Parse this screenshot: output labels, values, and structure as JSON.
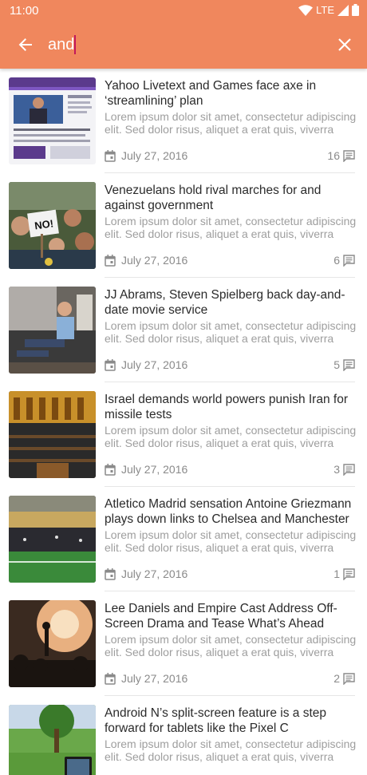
{
  "status_bar": {
    "time": "11:00",
    "network": "LTE"
  },
  "toolbar": {
    "search_value": "and",
    "back_icon": "arrow-back-icon",
    "clear_icon": "close-icon"
  },
  "colors": {
    "accent": "#f0875d",
    "caret": "#c2185b",
    "meta": "#8a8a8a",
    "excerpt": "#9e9e9e"
  },
  "results": [
    {
      "title": "Yahoo Livetext and Games face axe in ‘streamlining’ plan",
      "excerpt": "Lorem ipsum dolor sit amet, consectetur adipiscing elit. Sed dolor risus, aliquet a erat quis, viverra",
      "date": "July 27, 2016",
      "comments": "16",
      "thumb": "web-page-photo"
    },
    {
      "title": "Venezuelans hold rival marches for and against government",
      "excerpt": "Lorem ipsum dolor sit amet, consectetur adipiscing elit. Sed dolor risus, aliquet a erat quis, viverra",
      "date": "July 27, 2016",
      "comments": "6",
      "thumb": "protest-photo"
    },
    {
      "title": "JJ Abrams, Steven Spielberg back day-and-date movie service",
      "excerpt": "Lorem ipsum dolor sit amet, consectetur adipiscing elit. Sed dolor risus, aliquet a erat quis, viverra",
      "date": "July 27, 2016",
      "comments": "5",
      "thumb": "man-on-sofa-photo"
    },
    {
      "title": "Israel demands world powers punish Iran for missile tests",
      "excerpt": "Lorem ipsum dolor sit amet, consectetur adipiscing elit. Sed dolor risus, aliquet a erat quis, viverra",
      "date": "July 27, 2016",
      "comments": "3",
      "thumb": "parliament-photo"
    },
    {
      "title": "Atletico Madrid sensation Antoine Griezmann plays down links to Chelsea and Manchester",
      "excerpt": "Lorem ipsum dolor sit amet, consectetur adipiscing elit. Sed dolor risus, aliquet a erat quis, viverra",
      "date": "July 27, 2016",
      "comments": "1",
      "thumb": "stadium-photo"
    },
    {
      "title": "Lee Daniels and Empire Cast Address Off-Screen Drama and Tease What’s Ahead",
      "excerpt": "Lorem ipsum dolor sit amet, consectetur adipiscing elit. Sed dolor risus, aliquet a erat quis, viverra",
      "date": "July 27, 2016",
      "comments": "2",
      "thumb": "concert-photo"
    },
    {
      "title": "Android N’s split-screen feature is a step forward for tablets like the Pixel C",
      "excerpt": "Lorem ipsum dolor sit amet, consectetur adipiscing elit. Sed dolor risus, aliquet a erat quis, viverra",
      "date": "",
      "comments": "",
      "thumb": "tablet-in-park-photo"
    }
  ]
}
